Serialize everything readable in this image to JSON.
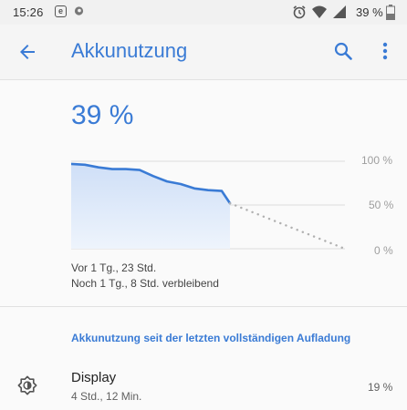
{
  "status_bar": {
    "time": "15:26",
    "notif_icon_1": "e",
    "battery_percent": "39 %"
  },
  "app_bar": {
    "title": "Akkunutzung"
  },
  "battery": {
    "level": "39 %",
    "since_text": "Vor 1 Tg., 23 Std.",
    "remaining_text": "Noch 1 Tg., 8 Std. verbleibend"
  },
  "chart_data": {
    "type": "area",
    "y_ticks": [
      "100 %",
      "50 %",
      "0 %"
    ],
    "ylim": [
      0,
      100
    ],
    "xlim": [
      0,
      1
    ],
    "history": {
      "x": [
        0,
        0.05,
        0.1,
        0.15,
        0.2,
        0.25,
        0.3,
        0.35,
        0.4,
        0.45,
        0.5,
        0.55,
        0.58
      ],
      "y": [
        97,
        96,
        93,
        91,
        91,
        90,
        83,
        77,
        74,
        69,
        67,
        66,
        52
      ]
    },
    "projection": {
      "x": [
        0.58,
        1.0
      ],
      "y": [
        52,
        0
      ]
    },
    "colors": {
      "line": "#3a7bd5",
      "fill": "#dbe7fa",
      "projection": "#b0b0b0",
      "grid": "#dcdcdc"
    }
  },
  "usage_section": {
    "heading": "Akkunutzung seit der letzten vollständigen Aufladung",
    "items": [
      {
        "name": "Display",
        "duration": "4 Std., 12 Min.",
        "percent": "19 %",
        "icon": "brightness-icon"
      }
    ]
  }
}
